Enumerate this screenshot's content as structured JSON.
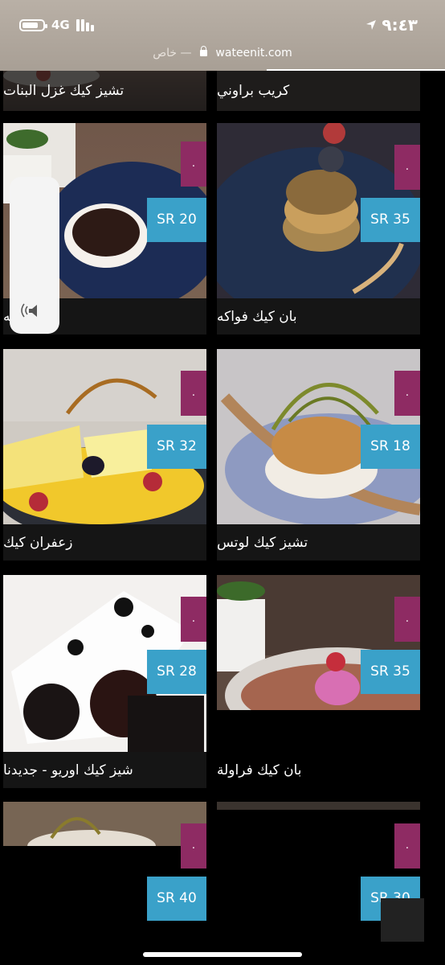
{
  "status": {
    "network": "4G",
    "time": "٩:٤٣"
  },
  "browser": {
    "private_label": "خاص",
    "separator": "—",
    "url": "wateenit.com"
  },
  "currency": "SR",
  "top_partial": {
    "left_name": "تشيز كيك غزل البنات",
    "right_name": "كريب براوني"
  },
  "items": [
    {
      "name": "سوفليه",
      "price": "SR 20",
      "badge": "."
    },
    {
      "name": "بان كيك فواكه",
      "price": "SR 35",
      "badge": "."
    },
    {
      "name": "زعفران كيك",
      "price": "SR 32",
      "badge": "."
    },
    {
      "name": "تشيز كيك لوتس",
      "price": "SR 18",
      "badge": "."
    },
    {
      "name": "شيز كيك اوريو - جديدنا",
      "price": "SR 28",
      "badge": "."
    },
    {
      "name": "بان كيك فراولة",
      "price": "SR 35",
      "badge": "."
    },
    {
      "name": "",
      "price": "SR 40",
      "badge": "."
    },
    {
      "name": "",
      "price": "SR 30",
      "badge": "."
    }
  ],
  "icons": {
    "navigation": "location-arrow-icon",
    "lock": "lock-icon",
    "volume": "speaker-icon",
    "battery": "battery-icon",
    "signal": "signal-bars-icon"
  }
}
